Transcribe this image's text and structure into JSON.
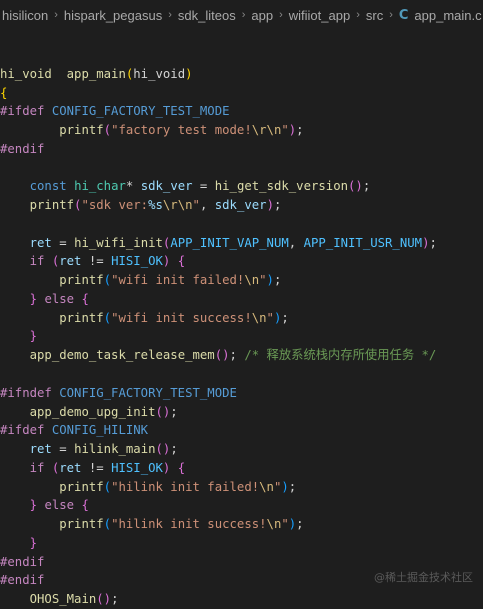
{
  "breadcrumb": {
    "items": [
      "hisilicon",
      "hispark_pegasus",
      "sdk_liteos",
      "app",
      "wifiiot_app",
      "src"
    ],
    "separator": "›",
    "file_icon": "C",
    "file_name": "app_main.c"
  },
  "code_lines": [
    [],
    [
      [
        "fn",
        "hi_void"
      ],
      [
        "",
        "  "
      ],
      [
        "fn",
        "app_main"
      ],
      [
        "brk1",
        "("
      ],
      [
        "",
        "hi_void"
      ],
      [
        "brk1",
        ")"
      ]
    ],
    [
      [
        "brk1",
        "{"
      ]
    ],
    [
      [
        "pp",
        "#ifdef"
      ],
      [
        "",
        ""
      ],
      [
        "macro",
        " CONFIG_FACTORY_TEST_MODE"
      ]
    ],
    [
      [
        "",
        "        "
      ],
      [
        "fn",
        "printf"
      ],
      [
        "brk2",
        "("
      ],
      [
        "str",
        "\"factory test mode!"
      ],
      [
        "esc",
        "\\r\\n"
      ],
      [
        "str",
        "\""
      ],
      [
        "brk2",
        ")"
      ],
      [
        "",
        ";"
      ]
    ],
    [
      [
        "pp",
        "#endif"
      ]
    ],
    [],
    [
      [
        "",
        "    "
      ],
      [
        "kw",
        "const"
      ],
      [
        "",
        " "
      ],
      [
        "ty",
        "hi_char"
      ],
      [
        "",
        "* "
      ],
      [
        "var",
        "sdk_ver"
      ],
      [
        "",
        " = "
      ],
      [
        "fn",
        "hi_get_sdk_version"
      ],
      [
        "brk2",
        "()"
      ],
      [
        "",
        ";"
      ]
    ],
    [
      [
        "",
        "    "
      ],
      [
        "fn",
        "printf"
      ],
      [
        "brk2",
        "("
      ],
      [
        "str",
        "\"sdk ver:"
      ],
      [
        "var",
        "%s"
      ],
      [
        "esc",
        "\\r\\n"
      ],
      [
        "str",
        "\""
      ],
      [
        "",
        ", "
      ],
      [
        "var",
        "sdk_ver"
      ],
      [
        "brk2",
        ")"
      ],
      [
        "",
        ";"
      ]
    ],
    [],
    [
      [
        "",
        "    "
      ],
      [
        "var",
        "ret"
      ],
      [
        "",
        " = "
      ],
      [
        "fn",
        "hi_wifi_init"
      ],
      [
        "brk2",
        "("
      ],
      [
        "const",
        "APP_INIT_VAP_NUM"
      ],
      [
        "",
        ", "
      ],
      [
        "const",
        "APP_INIT_USR_NUM"
      ],
      [
        "brk2",
        ")"
      ],
      [
        "",
        ";"
      ]
    ],
    [
      [
        "",
        "    "
      ],
      [
        "ctl",
        "if"
      ],
      [
        "",
        " "
      ],
      [
        "brk2",
        "("
      ],
      [
        "var",
        "ret"
      ],
      [
        "",
        " != "
      ],
      [
        "const",
        "HISI_OK"
      ],
      [
        "brk2",
        ")"
      ],
      [
        "",
        " "
      ],
      [
        "brk2",
        "{"
      ]
    ],
    [
      [
        "",
        "        "
      ],
      [
        "fn",
        "printf"
      ],
      [
        "brk3",
        "("
      ],
      [
        "str",
        "\"wifi init failed!"
      ],
      [
        "esc",
        "\\n"
      ],
      [
        "str",
        "\""
      ],
      [
        "brk3",
        ")"
      ],
      [
        "",
        ";"
      ]
    ],
    [
      [
        "",
        "    "
      ],
      [
        "brk2",
        "}"
      ],
      [
        "",
        " "
      ],
      [
        "ctl",
        "else"
      ],
      [
        "",
        " "
      ],
      [
        "brk2",
        "{"
      ]
    ],
    [
      [
        "",
        "        "
      ],
      [
        "fn",
        "printf"
      ],
      [
        "brk3",
        "("
      ],
      [
        "str",
        "\"wifi init success!"
      ],
      [
        "esc",
        "\\n"
      ],
      [
        "str",
        "\""
      ],
      [
        "brk3",
        ")"
      ],
      [
        "",
        ";"
      ]
    ],
    [
      [
        "",
        "    "
      ],
      [
        "brk2",
        "}"
      ]
    ],
    [
      [
        "",
        "    "
      ],
      [
        "fn",
        "app_demo_task_release_mem"
      ],
      [
        "brk2",
        "()"
      ],
      [
        "",
        "; "
      ],
      [
        "cm",
        "/* 释放系统栈内存所使用任务 */"
      ]
    ],
    [],
    [
      [
        "pp",
        "#ifndef"
      ],
      [
        "macro",
        " CONFIG_FACTORY_TEST_MODE"
      ]
    ],
    [
      [
        "",
        "    "
      ],
      [
        "fn",
        "app_demo_upg_init"
      ],
      [
        "brk2",
        "()"
      ],
      [
        "",
        ";"
      ]
    ],
    [
      [
        "pp",
        "#ifdef"
      ],
      [
        "macro",
        " CONFIG_HILINK"
      ]
    ],
    [
      [
        "",
        "    "
      ],
      [
        "var",
        "ret"
      ],
      [
        "",
        " = "
      ],
      [
        "fn",
        "hilink_main"
      ],
      [
        "brk2",
        "()"
      ],
      [
        "",
        ";"
      ]
    ],
    [
      [
        "",
        "    "
      ],
      [
        "ctl",
        "if"
      ],
      [
        "",
        " "
      ],
      [
        "brk2",
        "("
      ],
      [
        "var",
        "ret"
      ],
      [
        "",
        " != "
      ],
      [
        "const",
        "HISI_OK"
      ],
      [
        "brk2",
        ")"
      ],
      [
        "",
        " "
      ],
      [
        "brk2",
        "{"
      ]
    ],
    [
      [
        "",
        "        "
      ],
      [
        "fn",
        "printf"
      ],
      [
        "brk3",
        "("
      ],
      [
        "str",
        "\"hilink init failed!"
      ],
      [
        "esc",
        "\\n"
      ],
      [
        "str",
        "\""
      ],
      [
        "brk3",
        ")"
      ],
      [
        "",
        ";"
      ]
    ],
    [
      [
        "",
        "    "
      ],
      [
        "brk2",
        "}"
      ],
      [
        "",
        " "
      ],
      [
        "ctl",
        "else"
      ],
      [
        "",
        " "
      ],
      [
        "brk2",
        "{"
      ]
    ],
    [
      [
        "",
        "        "
      ],
      [
        "fn",
        "printf"
      ],
      [
        "brk3",
        "("
      ],
      [
        "str",
        "\"hilink init success!"
      ],
      [
        "esc",
        "\\n"
      ],
      [
        "str",
        "\""
      ],
      [
        "brk3",
        ")"
      ],
      [
        "",
        ";"
      ]
    ],
    [
      [
        "",
        "    "
      ],
      [
        "brk2",
        "}"
      ]
    ],
    [
      [
        "pp",
        "#endif"
      ]
    ],
    [
      [
        "pp",
        "#endif"
      ]
    ],
    [
      [
        "",
        "    "
      ],
      [
        "fn",
        "OHOS_Main"
      ],
      [
        "brk2",
        "()"
      ],
      [
        "",
        ";"
      ]
    ]
  ],
  "watermark": "@稀土掘金技术社区",
  "colors": {
    "background": "#1e1e1e",
    "keyword": "#569cd6",
    "function": "#dcdcaa",
    "string": "#ce9178",
    "preprocessor": "#c586c0",
    "comment": "#6a9955"
  }
}
